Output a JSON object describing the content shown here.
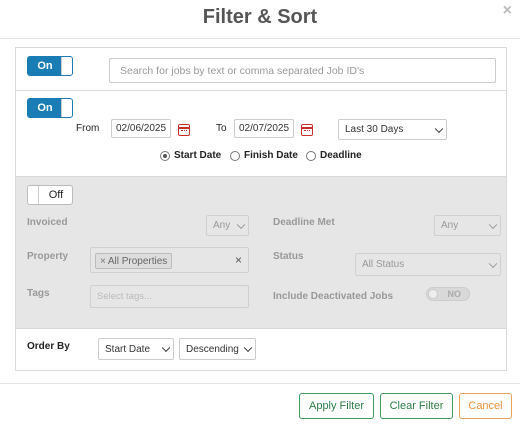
{
  "dialog": {
    "title": "Filter & Sort",
    "close_glyph": "×"
  },
  "search": {
    "toggle_label": "On",
    "placeholder": "Search for jobs by text or comma separated Job ID's"
  },
  "dates": {
    "toggle_label": "On",
    "from_label": "From",
    "from_value": "02/06/2025",
    "to_label": "To",
    "to_value": "02/07/2025",
    "range_select": "Last 30 Days",
    "radios": [
      {
        "label": "Start Date",
        "selected": true
      },
      {
        "label": "Finish Date",
        "selected": false
      },
      {
        "label": "Deadline",
        "selected": false
      }
    ]
  },
  "filters": {
    "toggle_label": "Off",
    "invoiced_label": "Invoiced",
    "invoiced_value": "Any",
    "deadline_met_label": "Deadline Met",
    "deadline_met_value": "Any",
    "property_label": "Property",
    "property_chip": "All Properties",
    "chip_x": "×",
    "clear_x": "×",
    "status_label": "Status",
    "status_value": "All Status",
    "tags_label": "Tags",
    "tags_placeholder": "Select tags...",
    "deactivated_label": "Include Deactivated Jobs",
    "deactivated_toggle": "NO"
  },
  "order": {
    "label": "Order By",
    "field_value": "Start Date",
    "direction_value": "Descending"
  },
  "footer": {
    "apply": "Apply Filter",
    "clear": "Clear Filter",
    "cancel": "Cancel"
  },
  "colors": {
    "toggle_blue": "#1a7cb4",
    "green": "#3e9b5c",
    "orange": "#e8913c",
    "calendar_red": "#c9302c"
  }
}
